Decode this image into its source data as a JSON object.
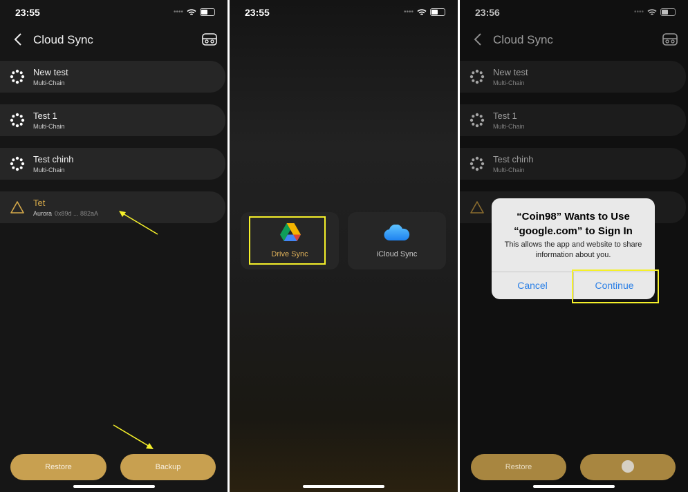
{
  "panel1": {
    "time": "23:55",
    "title": "Cloud Sync",
    "wallets": [
      {
        "name": "New test",
        "chain": "Multi-Chain"
      },
      {
        "name": "Test 1",
        "chain": "Multi-Chain"
      },
      {
        "name": "Test chinh",
        "chain": "Multi-Chain"
      }
    ],
    "pending": {
      "name": "Tet",
      "chain": "Aurora",
      "address": "0x89d ... 882aA"
    },
    "restore_label": "Restore",
    "backup_label": "Backup"
  },
  "panel2": {
    "time": "23:55",
    "drive_label": "Drive Sync",
    "icloud_label": "iCloud Sync"
  },
  "panel3": {
    "time": "23:56",
    "title": "Cloud Sync",
    "wallets": [
      {
        "name": "New test",
        "chain": "Multi-Chain"
      },
      {
        "name": "Test 1",
        "chain": "Multi-Chain"
      },
      {
        "name": "Test chinh",
        "chain": "Multi-Chain"
      }
    ],
    "alert": {
      "title_line1": "“Coin98” Wants to Use",
      "title_line2": "“google.com” to Sign In",
      "message": "This allows the app and website to share information about you.",
      "cancel": "Cancel",
      "continue": "Continue"
    },
    "restore_label": "Restore"
  },
  "colors": {
    "accent": "#c8a050",
    "highlight": "#f5f02a",
    "ios_blue": "#2a7fe6"
  },
  "icons": [
    "back-icon",
    "cloud-device-icon",
    "wallet-dots-icon",
    "warning-triangle-icon",
    "google-drive-icon",
    "icloud-icon",
    "loading-spinner-icon"
  ]
}
